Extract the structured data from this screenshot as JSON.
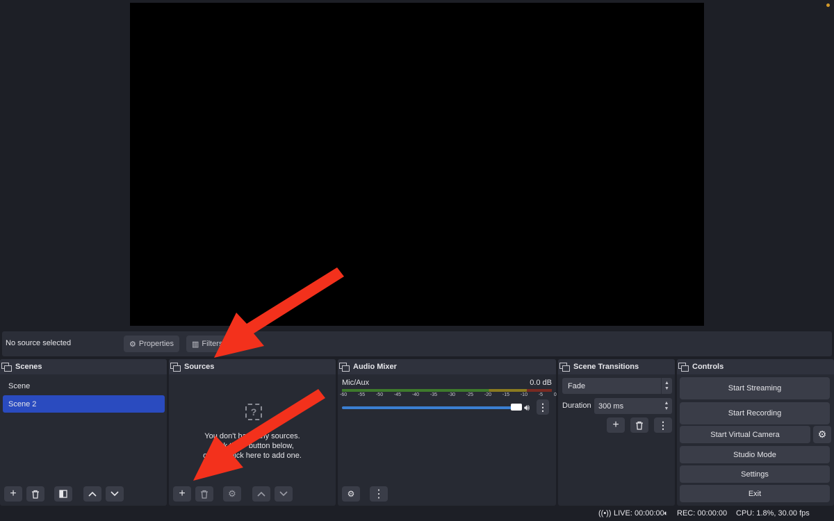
{
  "source_bar": {
    "no_source": "No source selected",
    "properties": "Properties",
    "filters": "Filters"
  },
  "scenes": {
    "title": "Scenes",
    "items": [
      "Scene",
      "Scene 2"
    ],
    "selected_index": 1
  },
  "sources": {
    "title": "Sources",
    "empty_line1": "You don't have any sources.",
    "empty_line2": "Click the + button below,",
    "empty_line3": "or right click here to add one."
  },
  "audio_mixer": {
    "title": "Audio Mixer",
    "channel": "Mic/Aux",
    "level": "0.0 dB",
    "ticks": [
      "-60",
      "-55",
      "-50",
      "-45",
      "-40",
      "-35",
      "-30",
      "-25",
      "-20",
      "-15",
      "-10",
      "-5",
      "0"
    ]
  },
  "scene_transitions": {
    "title": "Scene Transitions",
    "transition": "Fade",
    "duration_label": "Duration",
    "duration_value": "300 ms"
  },
  "controls": {
    "title": "Controls",
    "start_streaming": "Start Streaming",
    "start_recording": "Start Recording",
    "start_virtual_camera": "Start Virtual Camera",
    "studio_mode": "Studio Mode",
    "settings": "Settings",
    "exit": "Exit"
  },
  "status": {
    "live": "LIVE: 00:00:00",
    "rec": "REC: 00:00:00",
    "cpu": "CPU: 1.8%, 30.00 fps"
  },
  "colors": {
    "accent": "#2a4bbf",
    "annotation_arrow": "#f3311c"
  }
}
